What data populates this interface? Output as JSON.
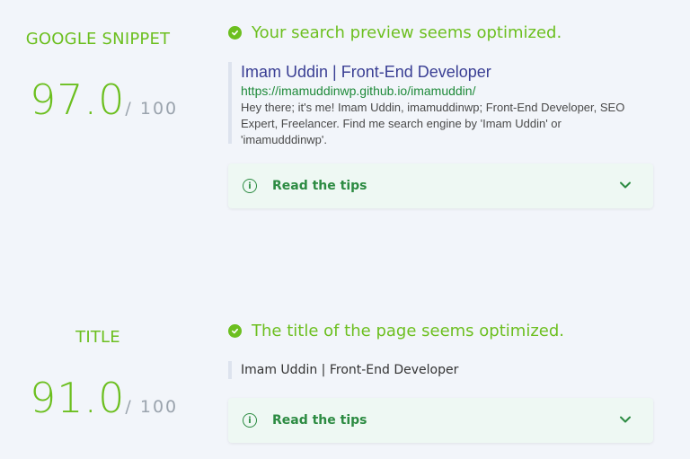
{
  "snippet": {
    "label": "GOOGLE SNIPPET",
    "score": "97.0",
    "score_max": "/ 100",
    "status": "Your search preview seems optimized.",
    "preview_title": "Imam Uddin | Front-End Developer",
    "preview_url": "https://imamuddinwp.github.io/imamuddin/",
    "preview_desc": "Hey there; it's me! Imam Uddin, imamuddinwp; Front-End Developer, SEO Expert, Freelancer. Find me search engine by 'Imam Uddin' or 'imamudddinwp'.",
    "tips_label": "Read the tips"
  },
  "title_section": {
    "label": "TITLE",
    "score": "91.0",
    "score_max": "/ 100",
    "status": "The title of the page seems optimized.",
    "title_text": "Imam Uddin | Front-End Developer",
    "tips_label": "Read the tips"
  },
  "colors": {
    "accent_green": "#6cbf1f",
    "tips_green": "#2c8b42",
    "link_blue": "#3a3f94",
    "background": "#f2f5fa"
  },
  "icons": [
    "check-circle-icon",
    "info-icon",
    "chevron-down-icon"
  ]
}
